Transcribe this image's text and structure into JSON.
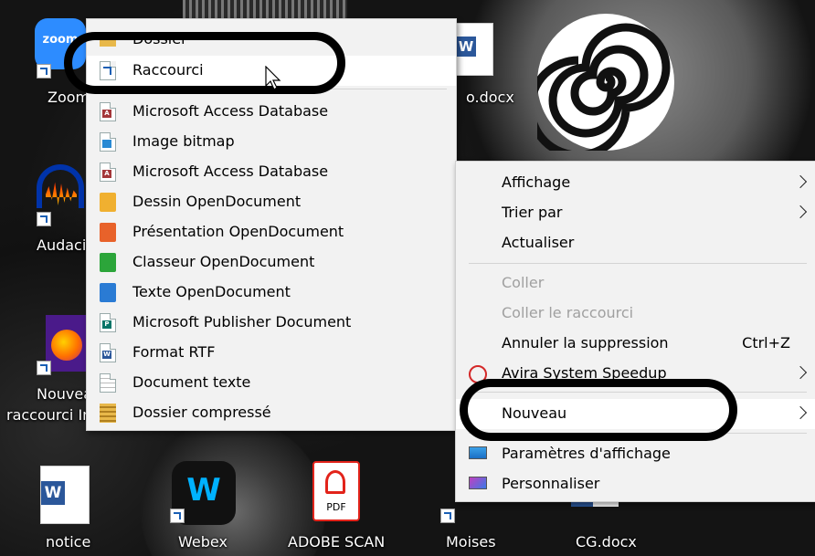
{
  "desktop_icons": [
    {
      "label": "Zoom",
      "color": "#2d8cff"
    },
    {
      "label": "Audaci",
      "color": "#ff8800"
    },
    {
      "label": "Nouvea",
      "label2": "raccourci In",
      "color": "#6b2fbf"
    },
    {
      "label": "notice",
      "color": "#2b579a"
    },
    {
      "label": "Webex",
      "color": "#00b2ff"
    },
    {
      "label": "ADOBE SCAN",
      "color": "#e2231a"
    },
    {
      "label": "Moises",
      "color": "#333333"
    },
    {
      "label": "CG.docx",
      "color": "#2b579a"
    },
    {
      "label": "o.docx",
      "color": "#2b579a"
    }
  ],
  "desktop_glyphs": {
    "zoom": "zoom",
    "webex_logo": "W",
    "pdf_label": "PDF",
    "word_letter": "W"
  },
  "new_submenu": {
    "items": [
      {
        "label": "Dossier",
        "icon": "folder-icon",
        "color": "#e8b84a"
      },
      {
        "label": "Raccourci",
        "icon": "shortcut-icon",
        "color": "#1a5fb4",
        "highlighted": true
      },
      {
        "label": "Microsoft Access Database",
        "icon": "access-icon",
        "color": "#a4373a"
      },
      {
        "label": "Image bitmap",
        "icon": "bitmap-icon",
        "color": "#2a8ad4"
      },
      {
        "label": "Microsoft Access Database",
        "icon": "access-icon",
        "color": "#a4373a"
      },
      {
        "label": "Dessin OpenDocument",
        "icon": "odg-icon",
        "color": "#f0b030"
      },
      {
        "label": "Présentation OpenDocument",
        "icon": "odp-icon",
        "color": "#e8622a"
      },
      {
        "label": "Classeur OpenDocument",
        "icon": "ods-icon",
        "color": "#2ca53a"
      },
      {
        "label": "Texte OpenDocument",
        "icon": "odt-icon",
        "color": "#2a7bd4"
      },
      {
        "label": "Microsoft Publisher Document",
        "icon": "publisher-icon",
        "color": "#077568"
      },
      {
        "label": "Format RTF",
        "icon": "rtf-icon",
        "color": "#2b579a"
      },
      {
        "label": "Document texte",
        "icon": "text-doc-icon",
        "color": "#888888"
      },
      {
        "label": "Dossier compressé",
        "icon": "zip-folder-icon",
        "color": "#e8b84a"
      }
    ],
    "icon_letters": {
      "access": "A",
      "publisher": "P",
      "rtf": "W"
    }
  },
  "context_menu": {
    "items": [
      {
        "label": "Affichage",
        "submenu": true
      },
      {
        "label": "Trier par",
        "submenu": true
      },
      {
        "label": "Actualiser"
      },
      {
        "label": "Coller",
        "disabled": true
      },
      {
        "label": "Coller le raccourci",
        "disabled": true
      },
      {
        "label": "Annuler la suppression",
        "shortcut": "Ctrl+Z"
      },
      {
        "label": "Avira System Speedup",
        "submenu": true,
        "icon": "avira-icon"
      },
      {
        "label": "Nouveau",
        "submenu": true,
        "highlighted": true
      },
      {
        "label": "Paramètres d'affichage",
        "icon": "display-icon"
      },
      {
        "label": "Personnaliser",
        "icon": "personalize-icon"
      }
    ]
  },
  "colors": {
    "menu_bg": "#f2f2f2",
    "highlight": "#ffffff",
    "disabled_text": "#a0a0a0",
    "annotation_ring": "#000000"
  }
}
